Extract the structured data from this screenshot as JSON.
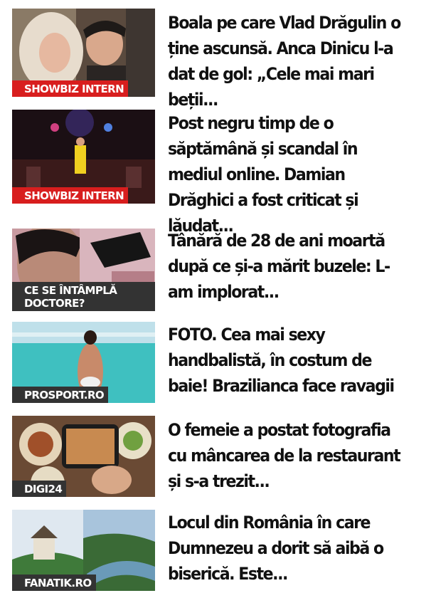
{
  "articles": [
    {
      "tag": "SHOWBIZ INTERN",
      "title": "Boala pe care Vlad Drăgulin o ține ascunsă. Anca Dinicu l-a dat de gol: „Cele mai mari beții...",
      "tag_color": "#d81e1e"
    },
    {
      "tag": "SHOWBIZ INTERN",
      "title": "Post negru timp de o săptămână și scandal în mediul online. Damian Drăghici a fost criticat și lăudat...",
      "tag_color": "#d81e1e"
    },
    {
      "tag": "CE SE ÎNTÂMPLĂ DOCTORE?",
      "title": "Tânără de 28 de ani moartă după ce și-a mărit buzele: L-am implorat...",
      "tag_color": "#333333"
    },
    {
      "tag": "PROSPORT.RO",
      "title": "FOTO. Cea mai sexy handbalistă, în costum de baie! Brazilianca face ravagii",
      "tag_color": "#333333"
    },
    {
      "tag": "DIGI24",
      "title": "O femeie a postat fotografia cu mâncarea de la restaurant și s-a trezit...",
      "tag_color": "#333333"
    },
    {
      "tag": "FANATIK.RO",
      "title": "Locul din România în care Dumnezeu a dorit să aibă o biserică. Este...",
      "tag_color": "#333333"
    }
  ]
}
